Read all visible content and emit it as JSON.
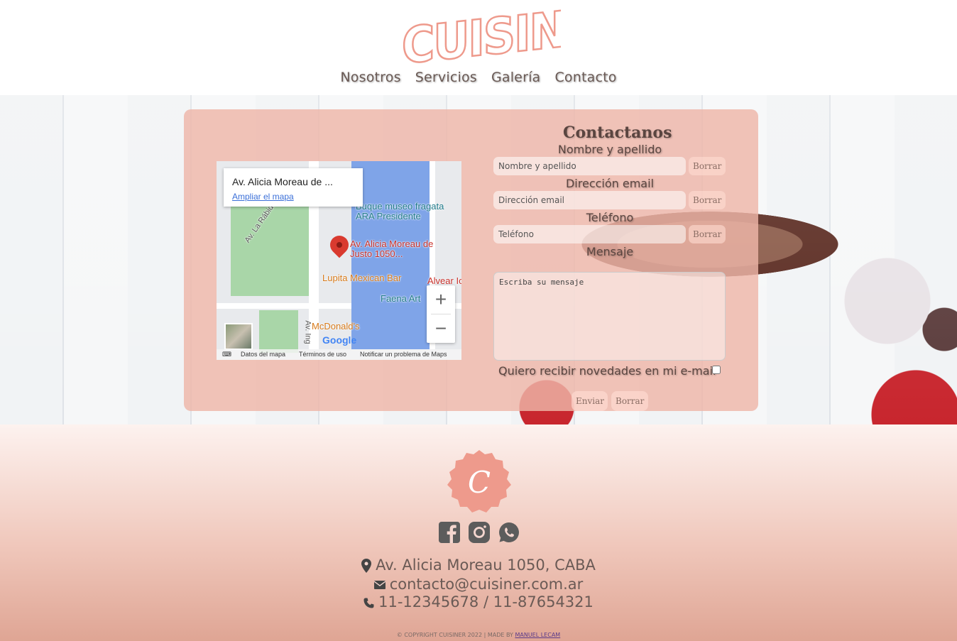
{
  "brand": {
    "logo_text": "CUISINER",
    "accent": "#ee9a8c"
  },
  "nav": {
    "items": [
      "Nosotros",
      "Servicios",
      "Galería",
      "Contacto"
    ]
  },
  "map": {
    "place_title": "Av. Alicia Moreau de ...",
    "enlarge_link": "Ampliar el mapa",
    "labels": {
      "street1": "Av. La Rábida",
      "museum": "Buque museo fragata ARA Presidente",
      "pin": "Av. Alicia Moreau de Justo 1050...",
      "lupita": "Lupita Mexican Bar",
      "alvear": "Alvear Ic",
      "faena": "Faena Art",
      "mcdonalds": "McDonald's",
      "street2": "Av. Ing"
    },
    "google": "Google",
    "zoom_in": "+",
    "zoom_out": "−",
    "footer": {
      "data": "Datos del mapa",
      "terms": "Términos de uso",
      "report": "Notificar un problema de Maps"
    }
  },
  "form": {
    "title": "Contactanos",
    "name_label": "Nombre y apellido",
    "name_placeholder": "Nombre y apellido",
    "email_label": "Dirección email",
    "email_placeholder": "Dirección email",
    "phone_label": "Teléfono",
    "phone_placeholder": "Teléfono",
    "message_label": "Mensaje",
    "message_placeholder": "Escriba su mensaje",
    "clear_label": "Borrar",
    "newsletter_label": "Quiero recibir novedades en mi e-mail",
    "newsletter_checked": false,
    "submit_label": "Enviar",
    "reset_label": "Borrar"
  },
  "footer": {
    "seal_letter": "C",
    "social": [
      "facebook-icon",
      "instagram-icon",
      "whatsapp-icon"
    ],
    "address": "Av. Alicia Moreau 1050, CABA",
    "email": "contacto@cuisiner.com.ar",
    "phone": "11-12345678 / 11-87654321",
    "copyright_prefix": "© COPYRIGHT CUISINER 2022 | MADE BY",
    "author": "MANUEL LECAM"
  }
}
